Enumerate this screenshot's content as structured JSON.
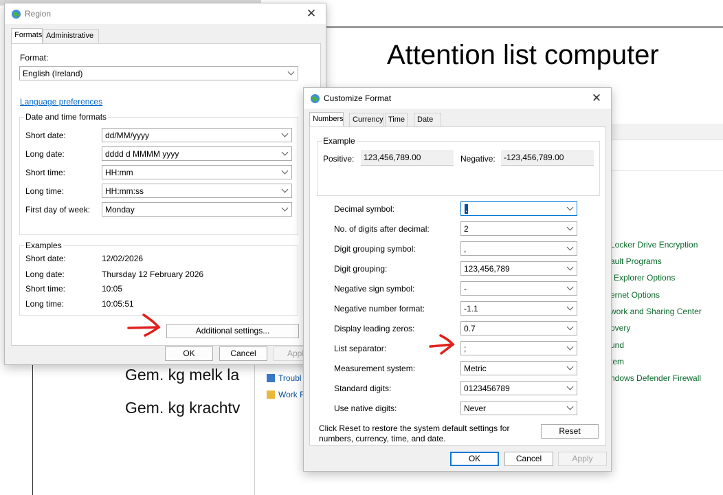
{
  "background": {
    "slide_title": "Attention list computer",
    "slide_lines": [
      "Gem. kg melk la",
      "Gem. kg krachtv"
    ],
    "control_panel_items": [
      "Locker Drive Encryption",
      "ault Programs",
      "Explorer Options",
      "ernet Options",
      "work and Sharing Center",
      "overy",
      "und",
      "tem",
      "ndows Defender Firewall"
    ],
    "control_panel_left_items": [
      "Troubl",
      "Work F"
    ]
  },
  "region": {
    "title": "Region",
    "tabs": [
      "Formats",
      "Administrative"
    ],
    "format_label": "Format:",
    "format_value": "English (Ireland)",
    "language_link": "Language preferences",
    "datetime_group": "Date and time formats",
    "fields": [
      {
        "label": "Short date:",
        "value": "dd/MM/yyyy"
      },
      {
        "label": "Long date:",
        "value": "dddd d MMMM yyyy"
      },
      {
        "label": "Short time:",
        "value": "HH:mm"
      },
      {
        "label": "Long time:",
        "value": "HH:mm:ss"
      },
      {
        "label": "First day of week:",
        "value": "Monday"
      }
    ],
    "examples_group": "Examples",
    "examples": [
      {
        "label": "Short date:",
        "value": "12/02/2026"
      },
      {
        "label": "Long date:",
        "value": "Thursday 12 February 2026"
      },
      {
        "label": "Short time:",
        "value": "10:05"
      },
      {
        "label": "Long time:",
        "value": "10:05:51"
      }
    ],
    "additional_settings": "Additional settings...",
    "ok": "OK",
    "cancel": "Cancel",
    "apply": "Apply"
  },
  "customize": {
    "title": "Customize Format",
    "tabs": [
      "Numbers",
      "Currency",
      "Time",
      "Date"
    ],
    "example_group": "Example",
    "positive_label": "Positive:",
    "positive_value": "123,456,789.00",
    "negative_label": "Negative:",
    "negative_value": "-123,456,789.00",
    "rows": [
      {
        "label": "Decimal symbol:",
        "value": "."
      },
      {
        "label": "No. of digits after decimal:",
        "value": "2"
      },
      {
        "label": "Digit grouping symbol:",
        "value": ","
      },
      {
        "label": "Digit grouping:",
        "value": "123,456,789"
      },
      {
        "label": "Negative sign symbol:",
        "value": "-"
      },
      {
        "label": "Negative number format:",
        "value": "-1.1"
      },
      {
        "label": "Display leading zeros:",
        "value": "0.7"
      },
      {
        "label": "List separator:",
        "value": ";"
      },
      {
        "label": "Measurement system:",
        "value": "Metric"
      },
      {
        "label": "Standard digits:",
        "value": "0123456789"
      },
      {
        "label": "Use native digits:",
        "value": "Never"
      }
    ],
    "reset_text_line1": "Click Reset to restore the system default settings for",
    "reset_text_line2": "numbers, currency, time, and date.",
    "reset": "Reset",
    "ok": "OK",
    "cancel": "Cancel",
    "apply": "Apply"
  },
  "annotation_color": "#e0201b"
}
